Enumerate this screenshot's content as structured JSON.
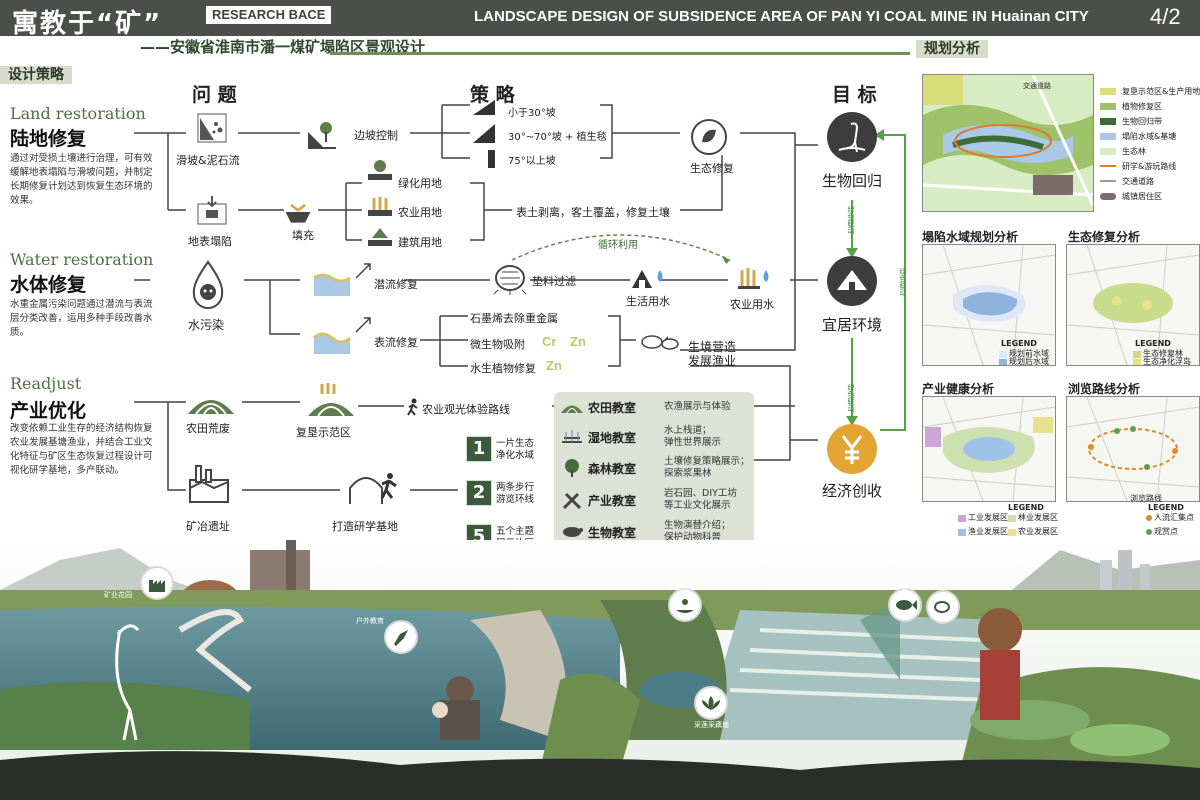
{
  "header": {
    "title_cn": "寓教于“矿”",
    "tag": "RESEARCH BACE",
    "title_en": "LANDSCAPE DESIGN OF SUBSIDENCE AREA OF  PAN YI COAL MINE IN Huainan CITY",
    "page": "4/2",
    "subtitle": "——安徽省淮南市潘一煤矿塌陷区景观设计"
  },
  "sections": {
    "strategy": "设计策略",
    "planning": "规划分析"
  },
  "columns": {
    "problem": "问 题",
    "strategy": "策 略",
    "goal": "目 标"
  },
  "rows": {
    "land": {
      "en": "Land restoration",
      "cn": "陆地修复",
      "desc": "通过对受损土壤进行治理，可有效缓解地表塌陷与滑坡问题，并制定长期修复计划达到恢复生态环境的效果。",
      "problems": [
        "滑坡&泥石流",
        "地表塌陷"
      ],
      "slope_control": "边坡控制",
      "slopes": [
        "小于30°坡",
        "30°~70°坡 + 植生毯",
        "75°以上坡"
      ],
      "fill": "填充",
      "land_uses": [
        "绿化用地",
        "农业用地",
        "建筑用地"
      ],
      "soil": "表土剥离，客土覆盖，修复土壤",
      "eco_repair": "生态修复"
    },
    "water": {
      "en": "Water restoration",
      "cn": "水体修复",
      "desc": "水重金属污染问题通过潜流与表流层分类改善，运用多种手段改善水质。",
      "problem": "水污染",
      "sub_flow": "潜流修复",
      "surface_flow": "表流修复",
      "filter": "垫料过滤",
      "recycle": "循环利用",
      "domestic": "生活用水",
      "agri_water": "农业用水",
      "methods": [
        "石墨烯去除重金属",
        "微生物吸附",
        "水生植物修复"
      ],
      "metals": [
        "Cr",
        "Zn",
        "Zn"
      ],
      "fishery": "生境营造\n发展渔业"
    },
    "industry": {
      "en": "Readjust",
      "cn": "产业优化",
      "desc": "改变依赖工业生存的经济结构恢复农业发展基塘渔业，并结合工业文化特征与矿区生态恢复过程设计可视化研学基地，多产联动。",
      "farmland": "农田荒废",
      "reclaim": "复垦示范区",
      "route": "农业观光体验路线",
      "mine": "矿冶遗址",
      "base": "打造研学基地"
    }
  },
  "steps": [
    {
      "num": "1",
      "text": "一片生态\n净化水域"
    },
    {
      "num": "2",
      "text": "两条步行\n游览环线"
    },
    {
      "num": "5",
      "text": "五个主题\n展示片区"
    }
  ],
  "classrooms": [
    {
      "name": "农田教室",
      "desc": "农渔展示与体验"
    },
    {
      "name": "湿地教室",
      "desc": "水上栈道；\n弹性世界展示"
    },
    {
      "name": "森林教室",
      "desc": "土壤修复策略展示；\n探索浆果林"
    },
    {
      "name": "产业教室",
      "desc": "岩石园、DIY工坊\n等工业文化展示"
    },
    {
      "name": "生物教室",
      "desc": "生物演替介绍；\n保护动物科普"
    }
  ],
  "goals": [
    "生物回归",
    "宜居环境",
    "经济创收"
  ],
  "goal_links": [
    "绿色联动",
    "绿色联动",
    "绿色联动"
  ],
  "planning": {
    "map_road": "交通道路",
    "legend": [
      {
        "label": "复垦示范区&生产用地",
        "color": "#d9de7a"
      },
      {
        "label": "植物修复区",
        "color": "#9dc26a"
      },
      {
        "label": "生物回归带",
        "color": "#3f6b35"
      },
      {
        "label": "塌陷水域&基塘",
        "color": "#a9c9e6"
      },
      {
        "label": "生态林",
        "color": "#d8ecc4"
      },
      {
        "label": "研学&游玩路线",
        "color": "#e07a2a"
      },
      {
        "label": "交通道路",
        "color": "#ffffff"
      },
      {
        "label": "城镇居住区",
        "color": "#7d6a6a"
      }
    ],
    "panels": [
      {
        "title": "塌陷水域规划分析",
        "legend_head": "LEGEND",
        "items": [
          {
            "label": "规划前水域",
            "color": "#dbe9f6"
          },
          {
            "label": "规划后水域",
            "color": "#8fb3dd"
          }
        ]
      },
      {
        "title": "生态修复分析",
        "legend_head": "LEGEND",
        "items": [
          {
            "label": "生态修复林",
            "color": "#c7dd8c"
          },
          {
            "label": "生态净化浮岛",
            "color": "#e8e08a"
          }
        ]
      },
      {
        "title": "产业健康分析",
        "legend_head": "LEGEND",
        "items": [
          {
            "label": "工业发展区",
            "color": "#c9a5d8"
          },
          {
            "label": "林业发展区",
            "color": "#cfe0b0"
          },
          {
            "label": "渔业发展区",
            "color": "#9fc3e8"
          },
          {
            "label": "农业发展区",
            "color": "#e8e08a"
          }
        ]
      },
      {
        "title": "浏览路线分析",
        "legend_head": "LEGEND",
        "route_label": "浏览路线",
        "items": [
          {
            "label": "人流汇集点",
            "color": "#e08a2a"
          },
          {
            "label": "观赏点",
            "color": "#5aa24a"
          }
        ]
      }
    ]
  },
  "scene_labels": [
    "矿业花园",
    "户外教育",
    "划船游览",
    "桑基鱼塘",
    "采莲采藕塘"
  ]
}
